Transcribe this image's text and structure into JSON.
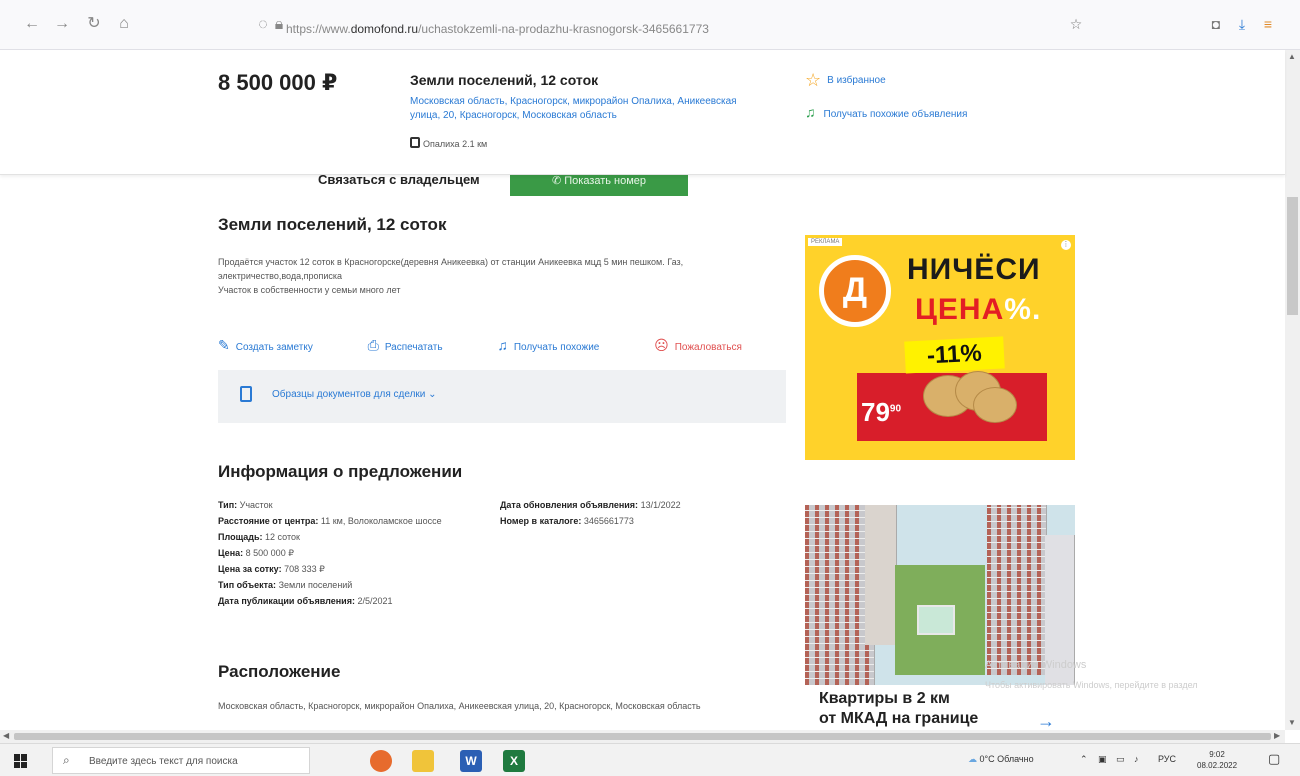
{
  "browser": {
    "url_prefix": "https://www.",
    "url_domain": "domofond.ru",
    "url_path": "/uchastokzemli-na-prodazhu-krasnogorsk-3465661773"
  },
  "header": {
    "price": "8 500 000 ₽",
    "title": "Земли поселений, 12 соток",
    "address": "Московская область, Красногорск, микрорайон Опалиха, Аникеевская улица, 20, Красногорск, Московская область",
    "station": "Опалиха 2.1 км",
    "favorite_label": "В избранное",
    "similar_label": "Получать похожие объявления"
  },
  "contact": {
    "label": "Связаться с владельцем",
    "show_phone_label": "Показать номер"
  },
  "listing": {
    "title": "Земли поселений, 12 соток",
    "description_line1": "Продаётся участок 12 соток в Красногорске(деревня Аникеевка) от станции Аникеевка мцд 5 мин пешком. Газ, электричество,вода,прописка",
    "description_line2": "Участок в собственности у семьи много лет",
    "actions": {
      "note": "Создать заметку",
      "print": "Распечатать",
      "similar": "Получать похожие",
      "complain": "Пожаловаться"
    },
    "docs_label": "Образцы документов для сделки"
  },
  "info": {
    "title": "Информация о предложении",
    "left": [
      {
        "k": "Тип:",
        "v": "Участок"
      },
      {
        "k": "Расстояние от центра:",
        "v": "11 км, Волоколамское шоссе"
      },
      {
        "k": "Площадь:",
        "v": "12 соток"
      },
      {
        "k": "Цена:",
        "v": "8 500 000 ₽"
      },
      {
        "k": "Цена за сотку:",
        "v": "708 333 ₽"
      },
      {
        "k": "Тип объекта:",
        "v": "Земли поселений"
      },
      {
        "k": "Дата публикации объявления:",
        "v": "2/5/2021"
      }
    ],
    "right": [
      {
        "k": "Дата обновления объявления:",
        "v": "13/1/2022"
      },
      {
        "k": "Номер в каталоге:",
        "v": "3465661773"
      }
    ]
  },
  "location": {
    "title": "Расположение",
    "address": "Московская область, Красногорск, микрорайон Опалиха, Аникеевская улица, 20, Красногорск, Московская область"
  },
  "ad1": {
    "tag": "РЕКЛАМА",
    "logo_letter": "Д",
    "line1": "НИЧЁСИ",
    "line2": "ЦЕНА",
    "pct": "%.",
    "discount": "-11%",
    "price": "79",
    "price_small": "90",
    "colors": {
      "bg": "#ffd22a",
      "accent": "#e31e24"
    }
  },
  "ad2": {
    "headline_line1": "Квартиры в 2 км",
    "headline_line2": "от МКАД на границе"
  },
  "watermark": {
    "line1": "Активация Windows",
    "line2": "Чтобы активировать Windows, перейдите в раздел"
  },
  "taskbar": {
    "search_placeholder": "Введите здесь текст для поиска",
    "weather": "0°C Облачно",
    "lang": "РУС",
    "time": "9:02",
    "date": "08.02.2022"
  }
}
